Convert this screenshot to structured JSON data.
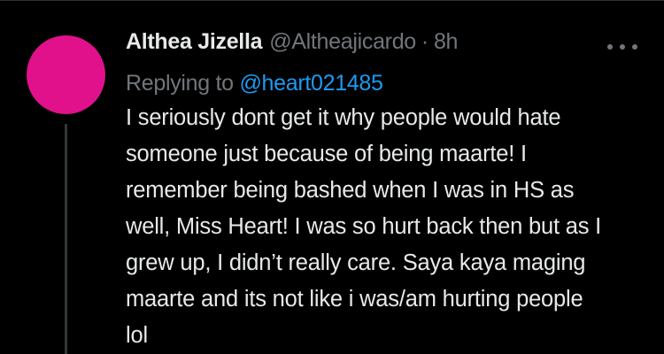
{
  "tweet": {
    "author": {
      "display_name": "Althea Jizella",
      "handle": "@Altheajicardo",
      "avatar_color": "#e0118a"
    },
    "separator": "·",
    "time": "8h",
    "replying_to_label": "Replying to",
    "replying_to_handle": "@heart021485",
    "text_lines": [
      "I seriously dont get it why people would hate",
      "someone just because of being maarte! I",
      "remember being bashed when I was in HS as",
      "well, Miss Heart! I was so hurt back then but as I",
      "grew up, I didn’t really care. Saya kaya maging",
      "maarte and its not like i was/am hurting people",
      "lol"
    ],
    "more_icon": "more-horizontal-icon"
  },
  "colors": {
    "background": "#000000",
    "text_primary": "#e7e9ea",
    "text_secondary": "#71767b",
    "link": "#1d9bf0",
    "thread_line": "#333639"
  }
}
